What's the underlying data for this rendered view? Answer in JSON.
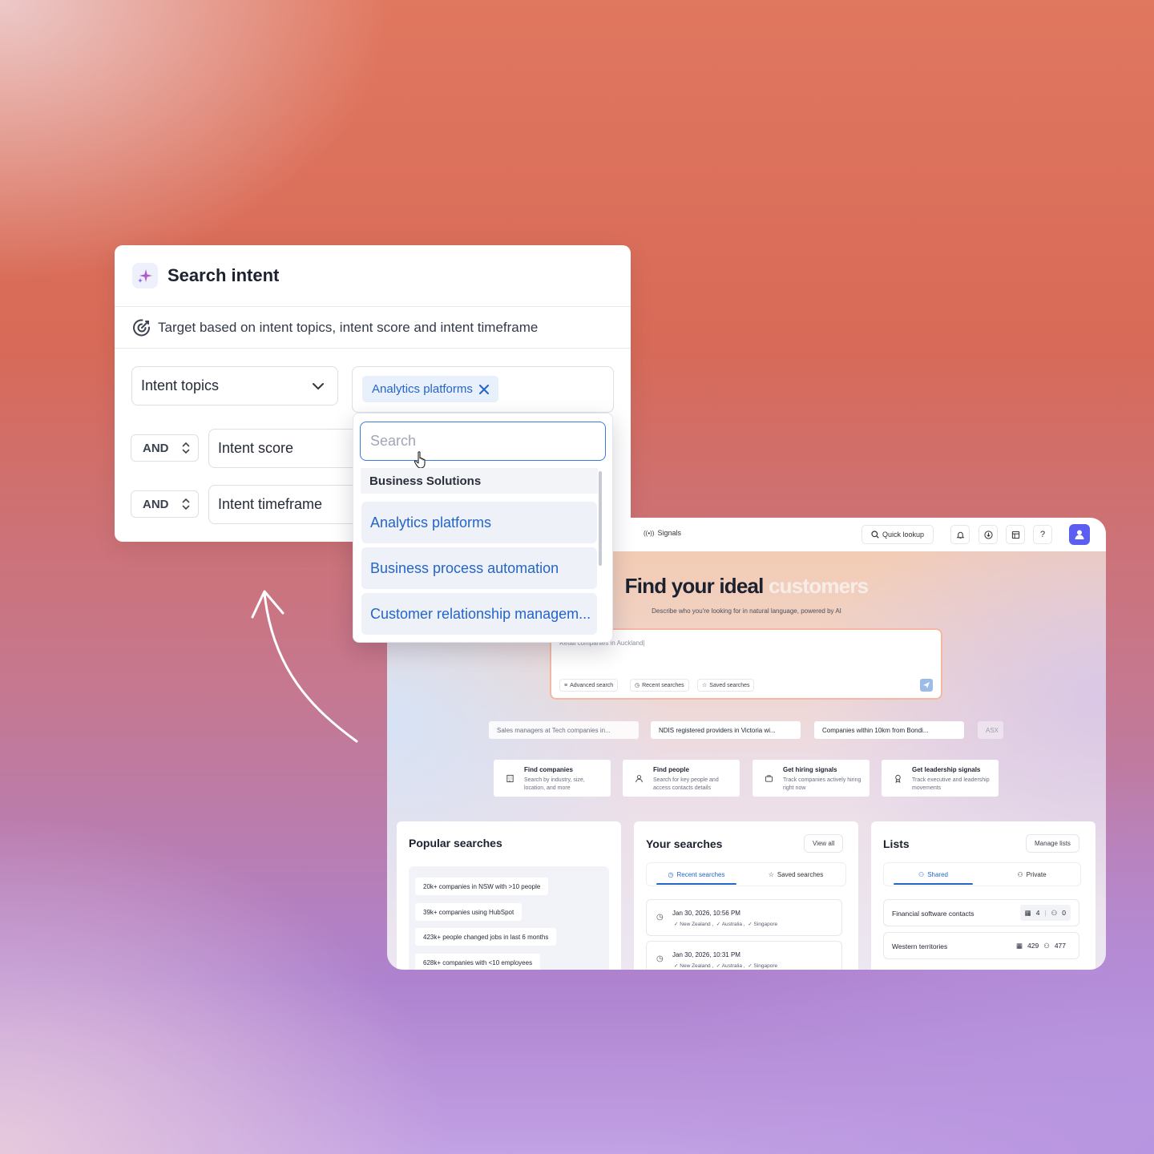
{
  "intent_card": {
    "title": "Search intent",
    "subtitle": "Target based on intent topics, intent score and intent timeframe",
    "topics_field": "Intent topics",
    "selected_chip": "Analytics platforms",
    "rows": [
      {
        "operator": "AND",
        "field": "Intent score"
      },
      {
        "operator": "AND",
        "field": "Intent timeframe"
      }
    ]
  },
  "dropdown": {
    "search_placeholder": "Search",
    "group_label": "Business Solutions",
    "items": [
      "Analytics platforms",
      "Business process automation",
      "Customer relationship managem..."
    ]
  },
  "app": {
    "nav_label": "Signals",
    "quick_lookup": "Quick lookup",
    "hero_title_main": "Find your ideal",
    "hero_title_accent": "customers",
    "hero_subtitle": "Describe who you're looking for in natural language, powered by AI",
    "prompt_value": "Retail companies in Auckland|",
    "prompt_buttons": [
      "Advanced search",
      "Recent searches",
      "Saved searches"
    ],
    "suggestions": [
      "Sales managers at Tech companies in...",
      "NDIS registered providers in Victoria wi...",
      "Companies within 10km from Bondi...",
      "ASX"
    ],
    "quick_cards": [
      {
        "title": "Find companies",
        "desc": "Search by industry, size, location, and more"
      },
      {
        "title": "Find people",
        "desc": "Search for key people and access contacts details"
      },
      {
        "title": "Get hiring signals",
        "desc": "Track companies actively hiring right now"
      },
      {
        "title": "Get leadership signals",
        "desc": "Track executive and leadership movements"
      }
    ],
    "popular": {
      "title": "Popular searches",
      "items": [
        "20k+ companies in NSW with >10 people",
        "39k+ companies using HubSpot",
        "423k+ people changed jobs in last 6 months",
        "628k+ companies with <10 employees"
      ]
    },
    "your_searches": {
      "title": "Your searches",
      "view_all": "View all",
      "tabs": [
        "Recent searches",
        "Saved searches"
      ],
      "items": [
        {
          "time": "Jan 30, 2026, 10:56 PM",
          "locations": [
            "New Zealand ,",
            "Australia ,",
            "Singapore"
          ]
        },
        {
          "time": "Jan 30, 2026, 10:31 PM",
          "locations": [
            "New Zealand ,",
            "Australia ,",
            "Singapore"
          ]
        }
      ]
    },
    "lists": {
      "title": "Lists",
      "manage": "Manage lists",
      "tabs": [
        "Shared",
        "Private"
      ],
      "items": [
        {
          "name": "Financial software contacts",
          "companies": "4",
          "people": "0"
        },
        {
          "name": "Western territories",
          "companies": "429",
          "people": "477"
        }
      ]
    }
  },
  "colors": {
    "accent_blue": "#2465c8",
    "chip_bg": "#e8f0fc",
    "avatar": "#5b5ef0"
  }
}
